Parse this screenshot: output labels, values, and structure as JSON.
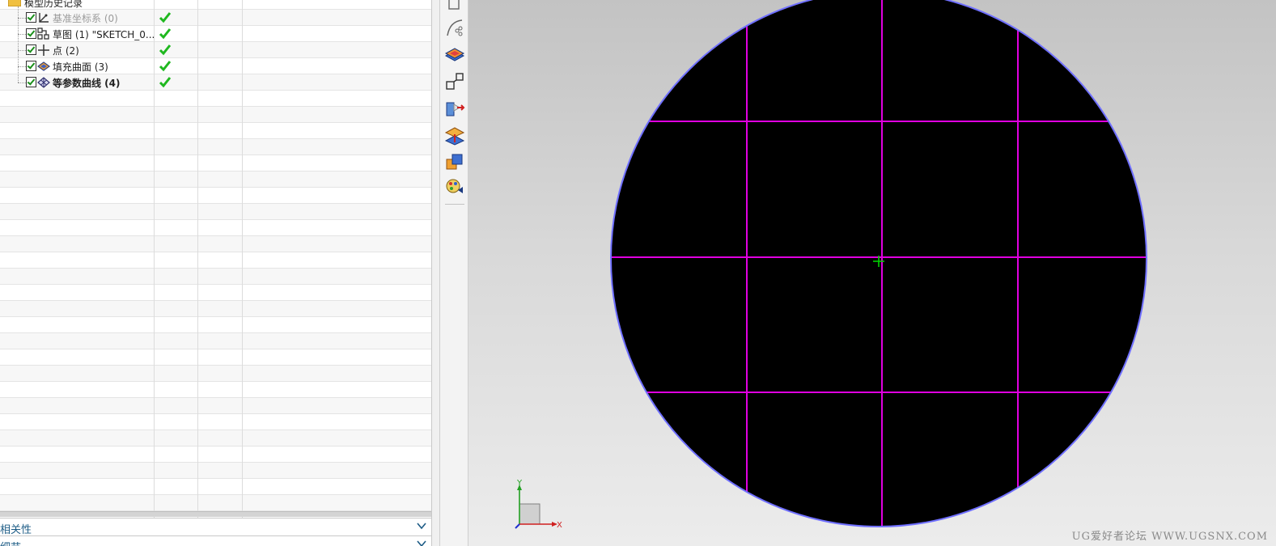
{
  "navigator": {
    "root_label": "模型历史记录",
    "features": [
      {
        "label": "基准坐标系 (0)",
        "icon": "datum-csys-icon",
        "style": "dim"
      },
      {
        "label": "草图 (1) \"SKETCH_0...",
        "icon": "sketch-icon",
        "style": "normal"
      },
      {
        "label": "点 (2)",
        "icon": "point-icon",
        "style": "normal"
      },
      {
        "label": "填充曲面 (3)",
        "icon": "fill-surface-icon",
        "style": "normal"
      },
      {
        "label": "等参数曲线 (4)",
        "icon": "isoparametric-curve-icon",
        "style": "bold"
      }
    ],
    "status_icon": "checkmark-icon",
    "status_color": "#1fb81f"
  },
  "panels": {
    "dependencies_label": "相关性",
    "details_label": "细节"
  },
  "toolbar": {
    "icons": [
      "snap-view-icon",
      "curve-sketch-icon",
      "surface-layer-icon",
      "scale-copy-icon",
      "extract-body-icon",
      "offset-face-icon",
      "boolean-unite-icon",
      "rendering-palette-icon"
    ]
  },
  "viewport": {
    "triad": {
      "x_label": "X",
      "y_label": "Y"
    },
    "watermark": "UG爱好者论坛 WWW.UGSNX.COM",
    "colors": {
      "face": "#000000",
      "edge": "#6f6fff",
      "isocurve": "#e000e0",
      "origin_marker": "#00d000"
    }
  }
}
